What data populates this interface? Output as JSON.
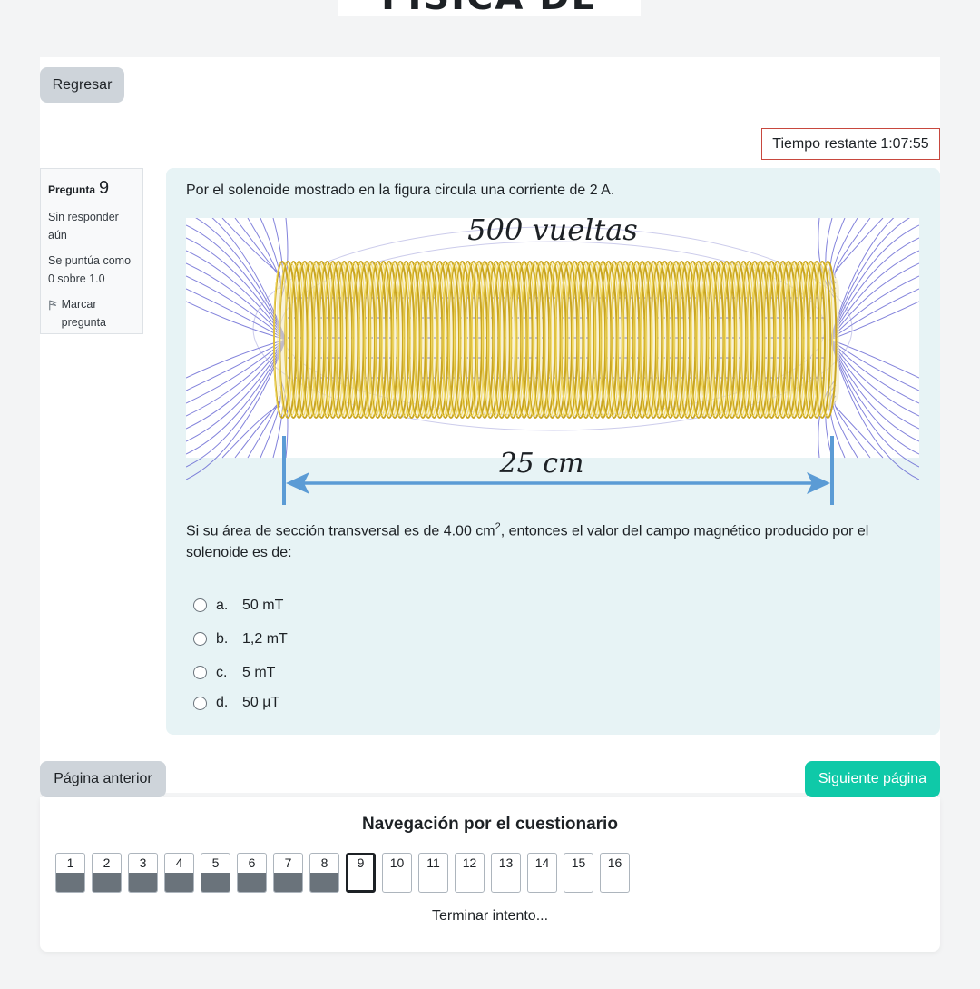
{
  "header": {
    "title": "FÍSICA DE CAMPOS"
  },
  "back_button": "Regresar",
  "timer": {
    "label": "Tiempo restante",
    "value": "1:07:55"
  },
  "question_info": {
    "label": "Pregunta",
    "number": "9",
    "state": "Sin responder aún",
    "grade": "Se puntúa como 0 sobre 1.0",
    "flag": "Marcar pregunta"
  },
  "question": {
    "intro": "Por el solenoide mostrado en la figura circula una corriente de 2 A.",
    "figure_turns": "500 vueltas",
    "figure_length": "25 cm",
    "text_before": "Si su área de sección transversal es de 4.00 cm",
    "text_sup": "2",
    "text_after": ", entonces el valor del campo magnético producido por el solenoide es de:",
    "options": [
      {
        "letter": "a.",
        "text": "50 mT"
      },
      {
        "letter": "b.",
        "text": "1,2 mT"
      },
      {
        "letter": "c.",
        "text": "5 mT"
      },
      {
        "letter": "d.",
        "text": "50 µT"
      }
    ]
  },
  "prev_button": "Página anterior",
  "next_button": "Siguiente página",
  "colors": {
    "accent": "#0fc9a8",
    "timer_border": "#c8483e",
    "question_bg": "#e7f3f5"
  },
  "navigation": {
    "title": "Navegación por el cuestionario",
    "buttons": [
      {
        "n": "1",
        "state": "answered"
      },
      {
        "n": "2",
        "state": "answered"
      },
      {
        "n": "3",
        "state": "answered"
      },
      {
        "n": "4",
        "state": "answered"
      },
      {
        "n": "5",
        "state": "answered"
      },
      {
        "n": "6",
        "state": "answered"
      },
      {
        "n": "7",
        "state": "answered"
      },
      {
        "n": "8",
        "state": "answered"
      },
      {
        "n": "9",
        "state": "current"
      },
      {
        "n": "10",
        "state": "unanswered"
      },
      {
        "n": "11",
        "state": "unanswered"
      },
      {
        "n": "12",
        "state": "unanswered"
      },
      {
        "n": "13",
        "state": "unanswered"
      },
      {
        "n": "14",
        "state": "unanswered"
      },
      {
        "n": "15",
        "state": "unanswered"
      },
      {
        "n": "16",
        "state": "unanswered"
      }
    ],
    "finish": "Terminar intento..."
  }
}
